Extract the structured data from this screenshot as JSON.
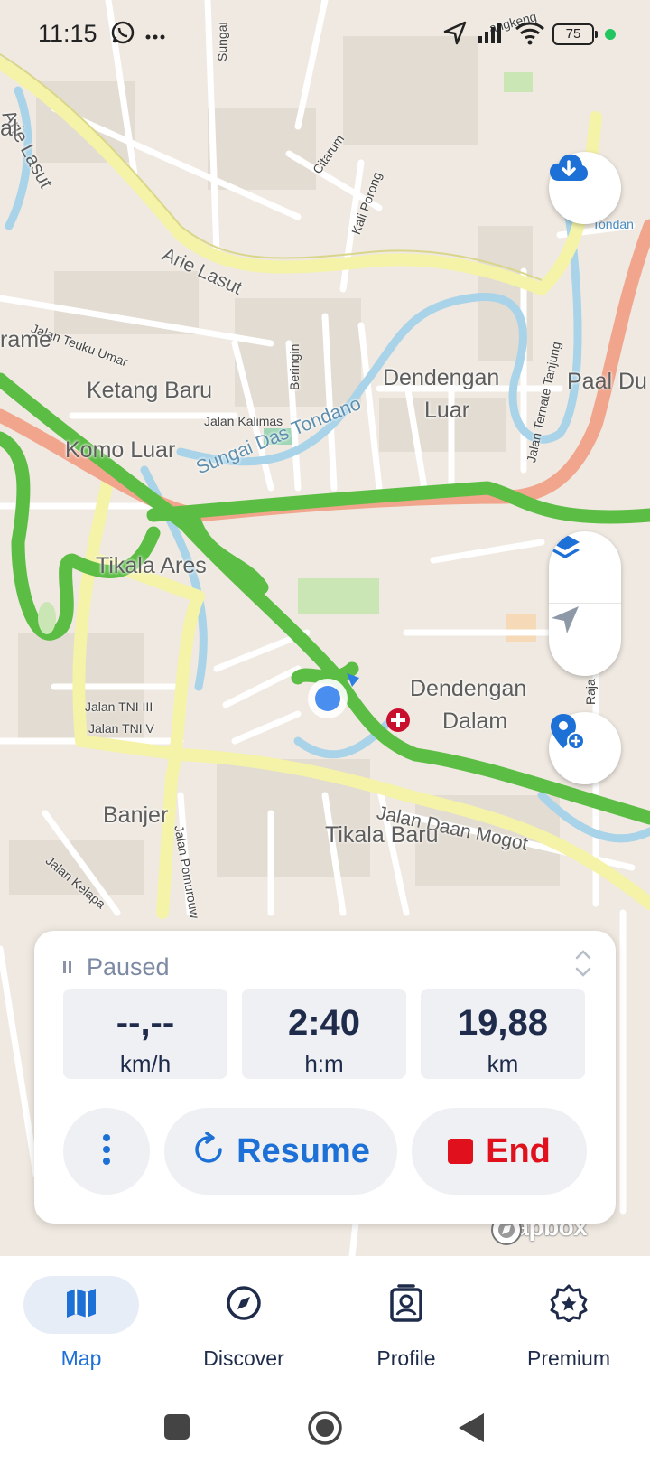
{
  "status_bar": {
    "time": "11:15",
    "battery": "75",
    "icons": [
      "whatsapp-icon",
      "more-dots-icon",
      "location-arrow-icon",
      "signal-icon",
      "wifi-icon",
      "battery-icon"
    ]
  },
  "map": {
    "labels": {
      "arie_lasut_1": "Arie Lasut",
      "arie_lasut_2": "Arie Lasut",
      "jalan_teuku_umar": "Jalan Teuku Umar",
      "rame": "rame",
      "ketang_baru": "Ketang Baru",
      "jalan_kalimas": "Jalan Kalimas",
      "komo_luar": "Komo Luar",
      "sungai_das_tondano": "Sungai Das Tondano",
      "beringin": "Beringin",
      "citarum": "Citarum",
      "kali_porong": "Kali Porong",
      "dendengan_luar_1": "Dendengan",
      "dendengan_luar_2": "Luar",
      "jalan_ternate_tanjung": "Jalan Ternate Tanjung",
      "paal_du": "Paal Du",
      "tikala_ares": "Tikala Ares",
      "dendengan_dalam_1": "Dendengan",
      "dendengan_dalam_2": "Dalam",
      "jalan_tni_iii": "Jalan TNI III",
      "jalan_tni_v": "Jalan TNI V",
      "banjer": "Banjer",
      "jalan_daan_mogot": "Jalan Daan Mogot",
      "tikala_baru": "Tikala Baru",
      "jalan_pomurouw": "Jalan Pomurouw",
      "jalan_kelapa": "Jalan Kelapa",
      "sungai": "Sungai",
      "raja": "Raja",
      "tondan": "Tondan",
      "al": "al",
      "angkeng": "angkeng"
    },
    "attribution": "mapbox",
    "controls": {
      "download": "cloud-download-icon",
      "layers": "layers-icon",
      "locate": "navigation-arrow-icon",
      "add_place": "add-location-icon"
    }
  },
  "tracking": {
    "status": "Paused",
    "stats": [
      {
        "value": "--,--",
        "unit": "km/h"
      },
      {
        "value": "2:40",
        "unit": "h:m"
      },
      {
        "value": "19,88",
        "unit": "km"
      }
    ],
    "buttons": {
      "resume": "Resume",
      "end": "End"
    }
  },
  "nav": {
    "items": [
      {
        "label": "Map",
        "icon": "map-icon",
        "active": true
      },
      {
        "label": "Discover",
        "icon": "compass-icon",
        "active": false
      },
      {
        "label": "Profile",
        "icon": "profile-badge-icon",
        "active": false
      },
      {
        "label": "Premium",
        "icon": "premium-badge-icon",
        "active": false
      }
    ]
  },
  "colors": {
    "accent": "#1d70d6",
    "end": "#e0101c",
    "route": "#5cbd45",
    "text_dark": "#1e2b4a"
  }
}
